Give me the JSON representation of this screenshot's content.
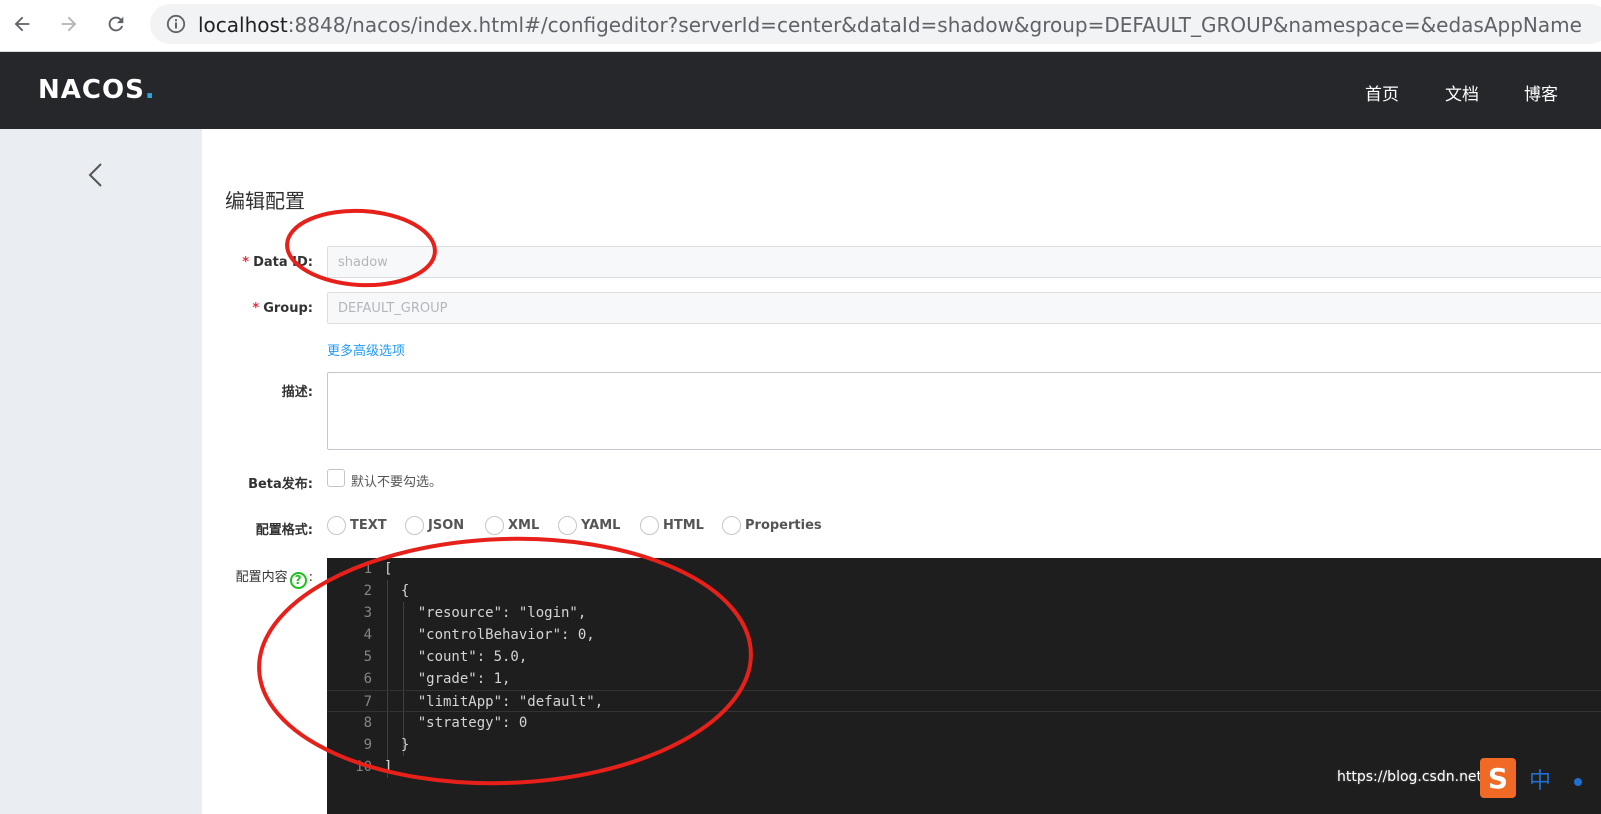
{
  "browser": {
    "url_host": "localhost",
    "url_rest": ":8848/nacos/index.html#/configeditor?serverId=center&dataId=shadow&group=DEFAULT_GROUP&namespace=&edasAppName"
  },
  "header": {
    "logo_main": "NACOS",
    "logo_dot": ".",
    "nav": [
      "首页",
      "文档",
      "博客"
    ]
  },
  "page": {
    "title": "编辑配置"
  },
  "form": {
    "required_mark": "*",
    "data_id_label": "Data ID:",
    "data_id_value": "shadow",
    "group_label": "Group:",
    "group_value": "DEFAULT_GROUP",
    "advanced_link": "更多高级选项",
    "desc_label": "描述:",
    "beta_label": "Beta发布:",
    "beta_hint": "默认不要勾选。",
    "format_label": "配置格式:",
    "formats": [
      "TEXT",
      "JSON",
      "XML",
      "YAML",
      "HTML",
      "Properties"
    ],
    "content_label": "配置内容",
    "content_label_suffix": ":",
    "help_glyph": "?"
  },
  "editor": {
    "lines": [
      {
        "n": "1",
        "code": "["
      },
      {
        "n": "2",
        "code": "  {"
      },
      {
        "n": "3",
        "code": "    \"resource\": \"login\","
      },
      {
        "n": "4",
        "code": "    \"controlBehavior\": 0,"
      },
      {
        "n": "5",
        "code": "    \"count\": 5.0,"
      },
      {
        "n": "6",
        "code": "    \"grade\": 1,"
      },
      {
        "n": "7",
        "code": "    \"limitApp\": \"default\","
      },
      {
        "n": "8",
        "code": "    \"strategy\": 0"
      },
      {
        "n": "9",
        "code": "  }"
      },
      {
        "n": "10",
        "code": "]"
      }
    ]
  },
  "watermark": "https://blog.csdn.net/",
  "ime": {
    "label": "中"
  },
  "colors": {
    "header_bg": "#25272a",
    "sidebar_bg": "#eaedf1",
    "link": "#209bfa",
    "required": "#e62e3d",
    "annotation": "#e8201a",
    "editor_bg": "#1e1e1e"
  }
}
